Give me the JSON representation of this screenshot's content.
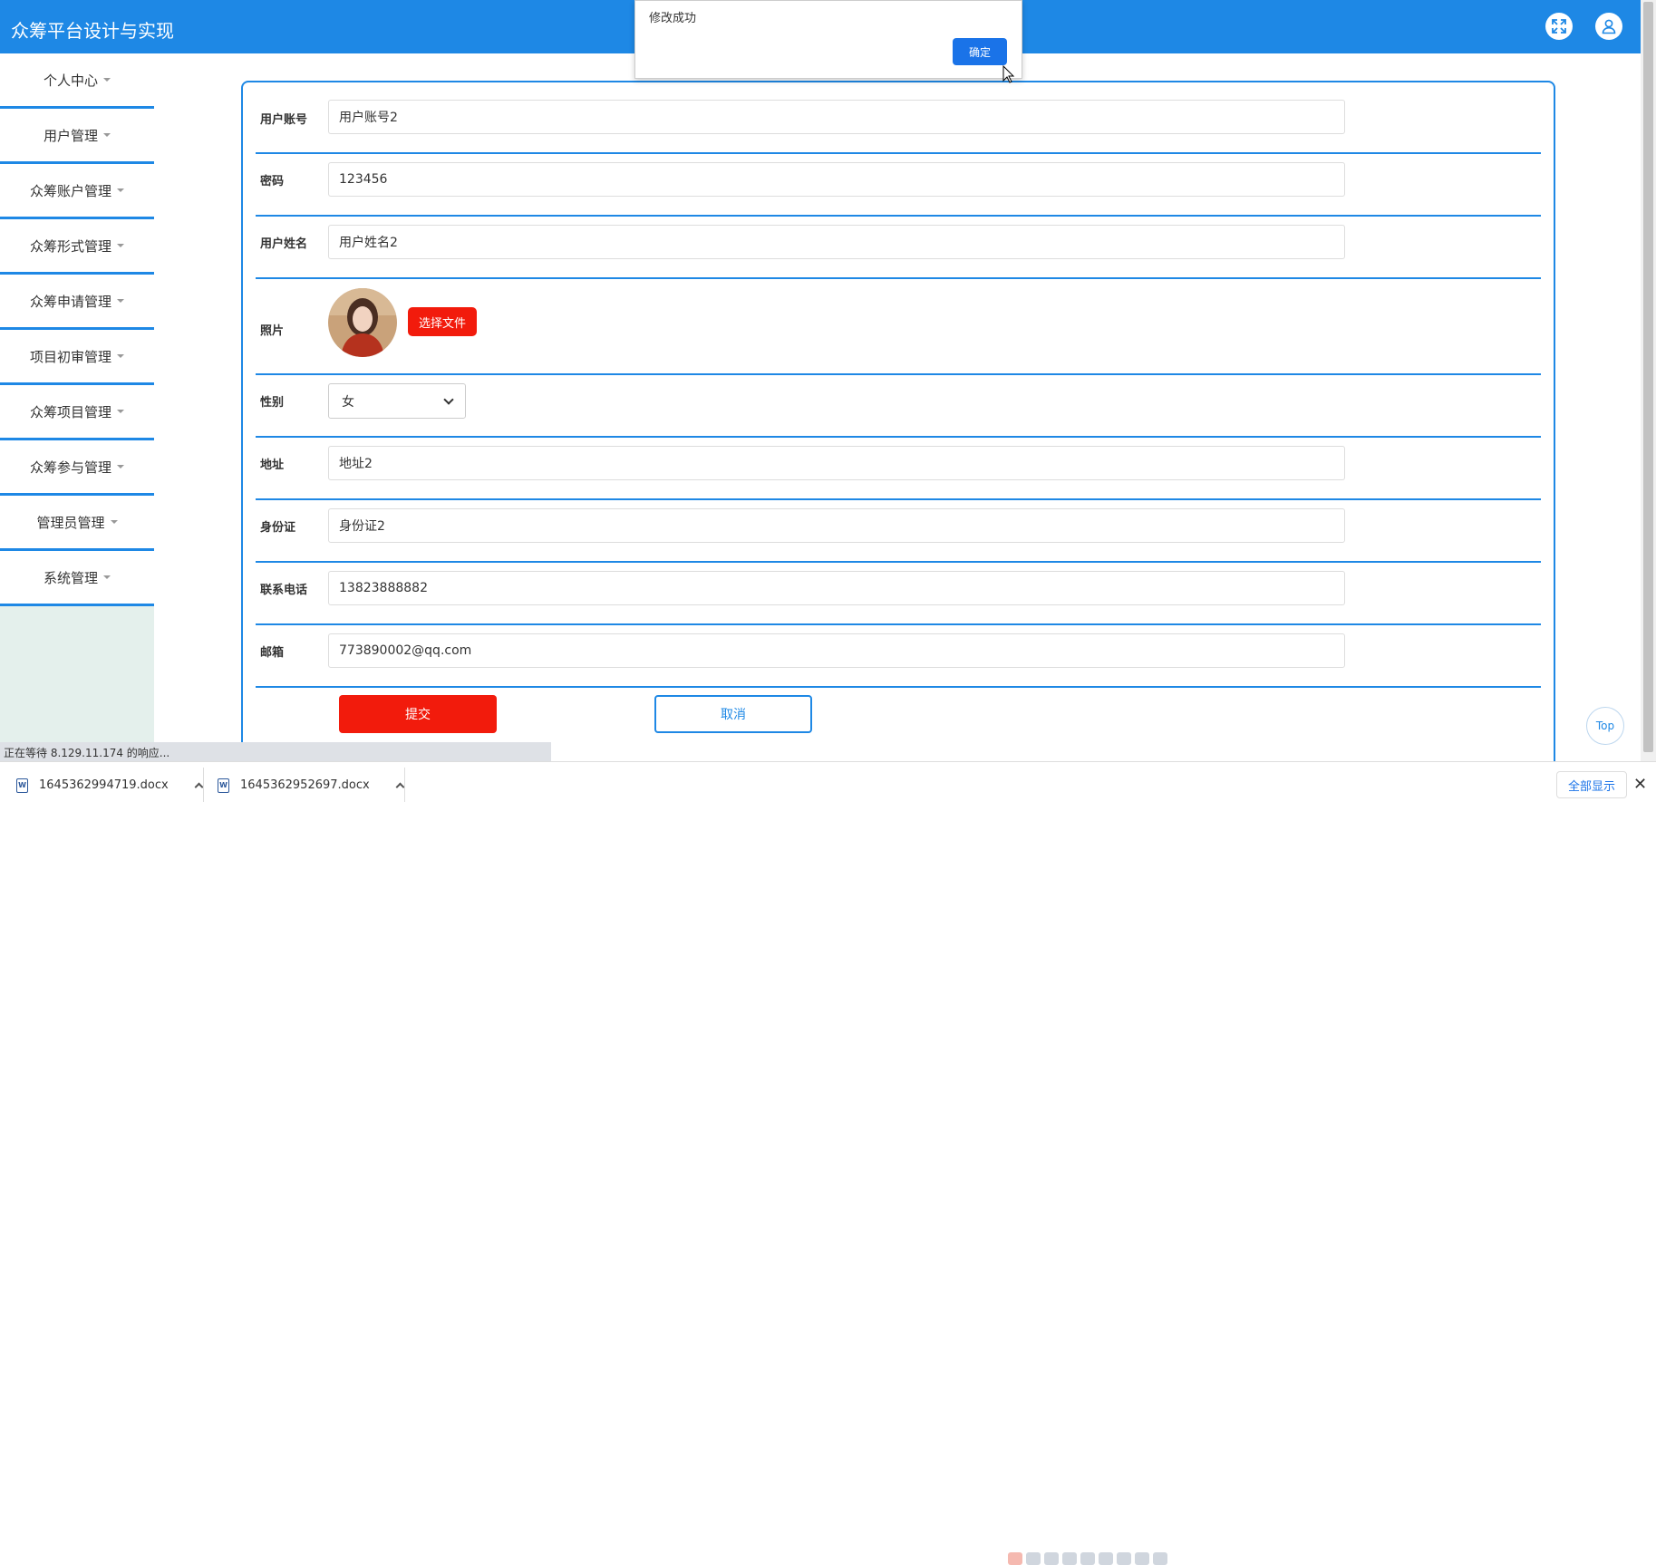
{
  "app": {
    "title": "众筹平台设计与实现"
  },
  "sidebar": {
    "items": [
      {
        "label": "个人中心"
      },
      {
        "label": "用户管理"
      },
      {
        "label": "众筹账户管理"
      },
      {
        "label": "众筹形式管理"
      },
      {
        "label": "众筹申请管理"
      },
      {
        "label": "项目初审管理"
      },
      {
        "label": "众筹项目管理"
      },
      {
        "label": "众筹参与管理"
      },
      {
        "label": "管理员管理"
      },
      {
        "label": "系统管理"
      }
    ]
  },
  "form": {
    "account": {
      "label": "用户账号",
      "value": "用户账号2"
    },
    "password": {
      "label": "密码",
      "value": "123456"
    },
    "name": {
      "label": "用户姓名",
      "value": "用户姓名2"
    },
    "photo": {
      "label": "照片",
      "button": "选择文件"
    },
    "gender": {
      "label": "性别",
      "value": "女"
    },
    "address": {
      "label": "地址",
      "value": "地址2"
    },
    "id_card": {
      "label": "身份证",
      "value": "身份证2"
    },
    "phone": {
      "label": "联系电话",
      "value": "13823888882"
    },
    "email": {
      "label": "邮箱",
      "value": "773890002@qq.com"
    },
    "submit": "提交",
    "cancel": "取消"
  },
  "dialog": {
    "message": "修改成功",
    "ok": "确定"
  },
  "top_button": "Top",
  "status_bar": "正在等待 8.129.11.174 的响应...",
  "downloads": {
    "items": [
      {
        "name": "1645362994719.docx"
      },
      {
        "name": "1645362952697.docx"
      }
    ],
    "show_all": "全部显示",
    "close": "✕"
  },
  "colors": {
    "primary": "#1e88e5",
    "danger": "#f21b0c",
    "dialog_button": "#1a73e8"
  }
}
